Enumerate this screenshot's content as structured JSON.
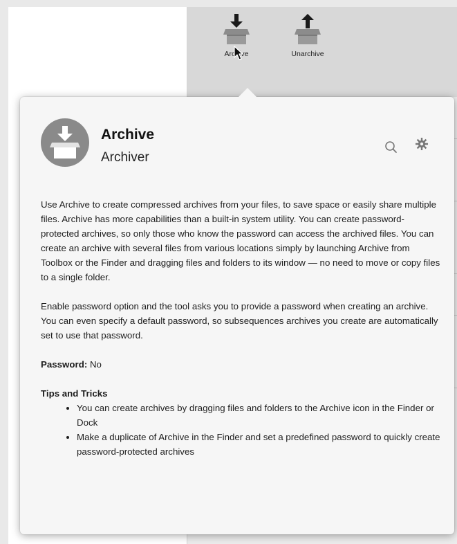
{
  "toolbar": {
    "archive_label": "Archive",
    "unarchive_label": "Unarchive"
  },
  "popover": {
    "title": "Archive",
    "subtitle": "Archiver",
    "description_1": "Use Archive to create compressed archives from your files, to save space or easily share multiple files. Archive has more capabilities than a built-in system utility. You can create password-protected archives, so only those who know the password can access the archived files. You can create an archive with several files from various locations simply by launching Archive from Toolbox or the Finder and dragging files and folders to its window — no need to move or copy files to a single folder.",
    "description_2": "Enable password option and the tool asks you to provide a password when creating an archive. You can even specify a default password, so subsequences archives you create are automatically set to use that password.",
    "password_label": "Password:",
    "password_value": "No",
    "tips_title": "Tips and Tricks",
    "tips": [
      "You can create archives by dragging files and folders to the Archive icon in the Finder or Dock",
      "Make a duplicate of Archive in the Finder and set a predefined password to quickly create password-protected archives"
    ]
  },
  "icons": {
    "archive": "archive-box-down-arrow-icon",
    "unarchive": "archive-box-up-arrow-icon",
    "search": "search-icon",
    "gear": "gear-icon",
    "cursor": "mouse-pointer-icon"
  }
}
